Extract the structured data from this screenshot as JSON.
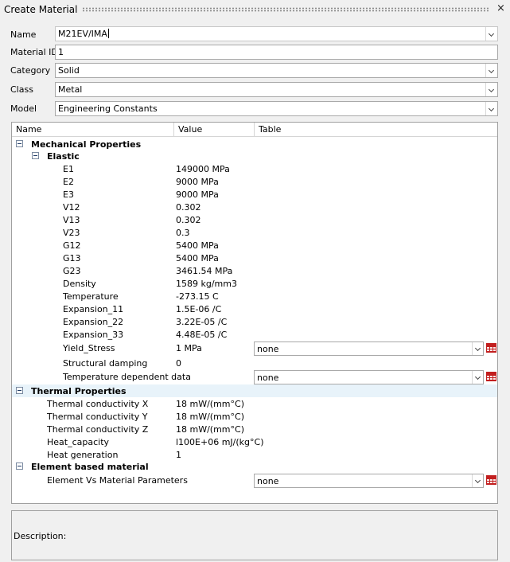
{
  "window": {
    "title": "Create Material",
    "close_glyph": "×"
  },
  "form": {
    "name_label": "Name",
    "name_value": "M21EV/IMA",
    "id_label": "Material ID",
    "id_value": "1",
    "category_label": "Category",
    "category_value": "Solid",
    "class_label": "Class",
    "class_value": "Metal",
    "model_label": "Model",
    "model_value": "Engineering Constants"
  },
  "tree": {
    "columns": {
      "name": "Name",
      "value": "Value",
      "table": "Table"
    },
    "mechanical": {
      "label": "Mechanical Properties",
      "elastic_label": "Elastic",
      "rows": [
        {
          "name": "E1",
          "value": "149000 MPa"
        },
        {
          "name": "E2",
          "value": "9000 MPa"
        },
        {
          "name": "E3",
          "value": "9000 MPa"
        },
        {
          "name": "V12",
          "value": "0.302"
        },
        {
          "name": "V13",
          "value": "0.302"
        },
        {
          "name": "V23",
          "value": "0.3"
        },
        {
          "name": "G12",
          "value": "5400 MPa"
        },
        {
          "name": "G13",
          "value": "5400 MPa"
        },
        {
          "name": "G23",
          "value": "3461.54 MPa"
        },
        {
          "name": "Density",
          "value": "1589 kg/mm3"
        },
        {
          "name": "Temperature",
          "value": "-273.15 C"
        },
        {
          "name": "Expansion_11",
          "value": "1.5E-06 /C"
        },
        {
          "name": "Expansion_22",
          "value": "3.22E-05 /C"
        },
        {
          "name": "Expansion_33",
          "value": "4.48E-05 /C"
        }
      ],
      "yield_name": "Yield_Stress",
      "yield_value": "1 MPa",
      "yield_table": "none",
      "damping_name": "Structural damping",
      "damping_value": "0",
      "tempdep_name": "Temperature dependent data",
      "tempdep_table": "none"
    },
    "thermal": {
      "label": "Thermal Properties",
      "rows": [
        {
          "name": "Thermal conductivity X",
          "value": "18 mW/(mm°C)"
        },
        {
          "name": "Thermal conductivity Y",
          "value": "18 mW/(mm°C)"
        },
        {
          "name": "Thermal conductivity Z",
          "value": "18 mW/(mm°C)"
        },
        {
          "name": "Heat_capacity",
          "value": "l100E+06 mJ/(kg°C)"
        },
        {
          "name": "Heat generation",
          "value": "1"
        }
      ]
    },
    "element": {
      "label": "Element based material",
      "param_name": "Element Vs Material Parameters",
      "param_table": "none"
    }
  },
  "description": {
    "label": "Description:"
  },
  "colors": {
    "table_icon": "#c21f1f",
    "row_highlight": "#e8f3fa"
  }
}
